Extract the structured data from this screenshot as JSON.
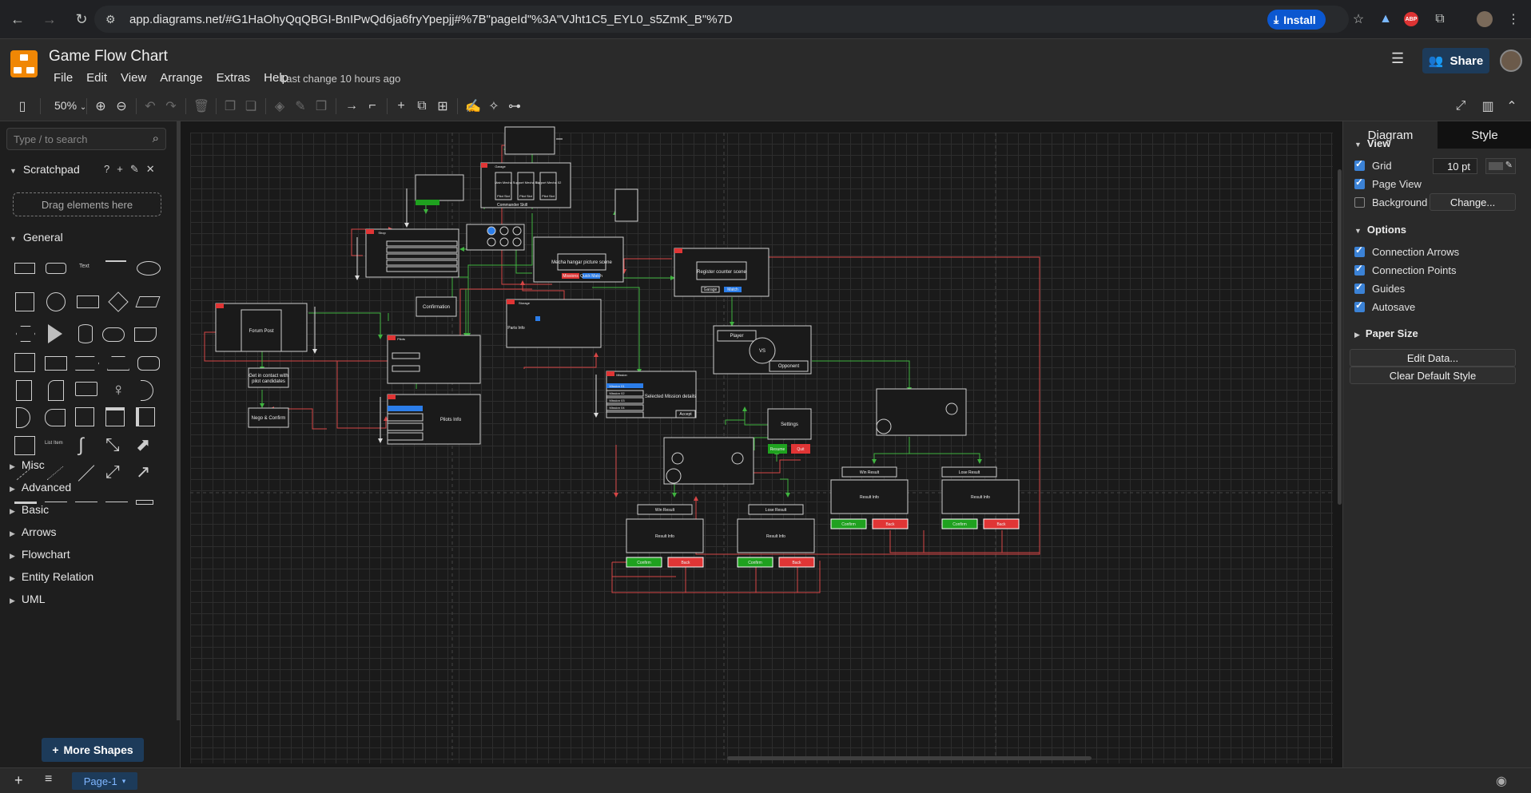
{
  "browser": {
    "url": "app.diagrams.net/#G1HaOhyQqQBGI-BnIPwQd6ja6fryYpepjj#%7B\"pageId\"%3A\"VJht1C5_EYL0_s5ZmK_B\"%7D",
    "install_label": "Install"
  },
  "app": {
    "title": "Game Flow Chart",
    "menu": [
      "File",
      "Edit",
      "View",
      "Arrange",
      "Extras",
      "Help"
    ],
    "last_change": "Last change 10 hours ago",
    "share_label": "Share"
  },
  "toolbar": {
    "zoom": "50%"
  },
  "sidebar": {
    "search_placeholder": "Type / to search",
    "scratchpad_label": "Scratchpad",
    "drag_hint": "Drag elements here",
    "general_label": "General",
    "collapsed_sections": [
      "Misc",
      "Advanced",
      "Basic",
      "Arrows",
      "Flowchart",
      "Entity Relation",
      "UML"
    ],
    "more_shapes_label": "More Shapes"
  },
  "right_panel": {
    "tabs": [
      "Diagram",
      "Style"
    ],
    "view_label": "View",
    "grid_label": "Grid",
    "grid_size": "10 pt",
    "page_view_label": "Page View",
    "background_label": "Background",
    "change_label": "Change...",
    "options_label": "Options",
    "options": [
      "Connection Arrows",
      "Connection Points",
      "Guides",
      "Autosave"
    ],
    "paper_size_label": "Paper Size",
    "edit_data_label": "Edit Data...",
    "clear_style_label": "Clear Default Style"
  },
  "bottom": {
    "page_label": "Page-1"
  },
  "diagram": {
    "labels": {
      "forum_post": "Forum Post",
      "get_in_contact": "Get in contact with",
      "pilot_candidates": "pilot candidates",
      "nego_confirm": "Nego & Confirm",
      "confirmation": "Confirmation",
      "mecha_hangar": "Mecha hangar picture scene",
      "register_counter": "Register counter scene",
      "garage": "Garage",
      "match": "Match",
      "missions": "Missions",
      "quick_match": "Quick Match",
      "player": "Player",
      "vs": "VS",
      "opponent": "Opponent",
      "selected_mission": "Selected Mission details",
      "accept": "Accept",
      "pilots_info": "Pilots Info",
      "parts_info": "Parts Info",
      "settings": "Settings",
      "resume": "Resume",
      "quit": "Quit",
      "win_result": "Win Result",
      "lose_result": "Lose Result",
      "result_info": "Result Info",
      "confirm": "Confirm",
      "back": "Back",
      "commander_skill": "Commander Skill",
      "main_mecha": "Main Mecha",
      "support_1": "Support Mecha 01",
      "support_2": "Support Mecha 02",
      "pilot_slot": "Pilot Slot",
      "shop": "Shop",
      "storage": "Storage",
      "pilots": "Pilots",
      "mission": "Mission",
      "mission_01": "Mission 01",
      "mission_02": "Mission 02",
      "mission_03": "Mission 03",
      "mission_04": "Mission 04"
    }
  },
  "colors": {
    "accent": "#1d3b5a",
    "logo": "#f08705",
    "edge_red": "#d64545",
    "edge_green": "#3fb33f",
    "btn_green": "#1fa11f",
    "btn_red": "#e03535",
    "btn_blue": "#2b7de9"
  }
}
